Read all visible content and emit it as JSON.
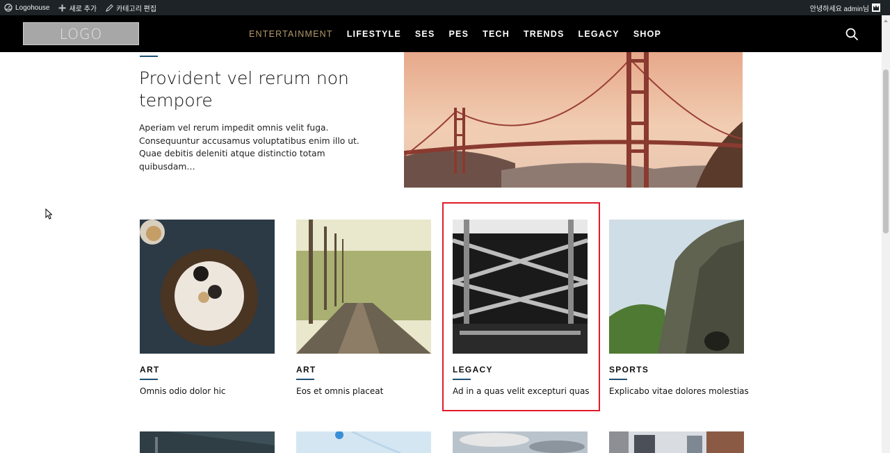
{
  "admin_bar": {
    "site_name": "Logohouse",
    "add_new": "새로 추가",
    "edit_category": "카테고리 편집",
    "greeting": "안녕하세요 admin님"
  },
  "header": {
    "logo_text": "LOGO",
    "nav": [
      {
        "label": "ENTERTAINMENT",
        "active": true
      },
      {
        "label": "LIFESTYLE",
        "active": false
      },
      {
        "label": "SES",
        "active": false
      },
      {
        "label": "PES",
        "active": false
      },
      {
        "label": "TECH",
        "active": false
      },
      {
        "label": "TRENDS",
        "active": false
      },
      {
        "label": "LEGACY",
        "active": false
      },
      {
        "label": "SHOP",
        "active": false
      }
    ],
    "search_icon": "search-icon"
  },
  "featured": {
    "title": "Provident vel rerum non tempore",
    "excerpt": "Aperiam vel rerum impedit omnis velit fuga. Consequuntur accusamus voluptatibus enim illo ut. Quae debitis deleniti atque distinctio totam quibusdam…"
  },
  "cards": [
    {
      "category": "ART",
      "title": "Omnis odio dolor hic"
    },
    {
      "category": "ART",
      "title": "Eos et omnis placeat"
    },
    {
      "category": "LEGACY",
      "title": "Ad in a quas velit excepturi quas"
    },
    {
      "category": "SPORTS",
      "title": "Explicabo vitae dolores molestias"
    }
  ],
  "colors": {
    "accent_nav_active": "#b49a6d",
    "category_underline": "#1d4f73",
    "highlight_border": "#e11a2b"
  }
}
